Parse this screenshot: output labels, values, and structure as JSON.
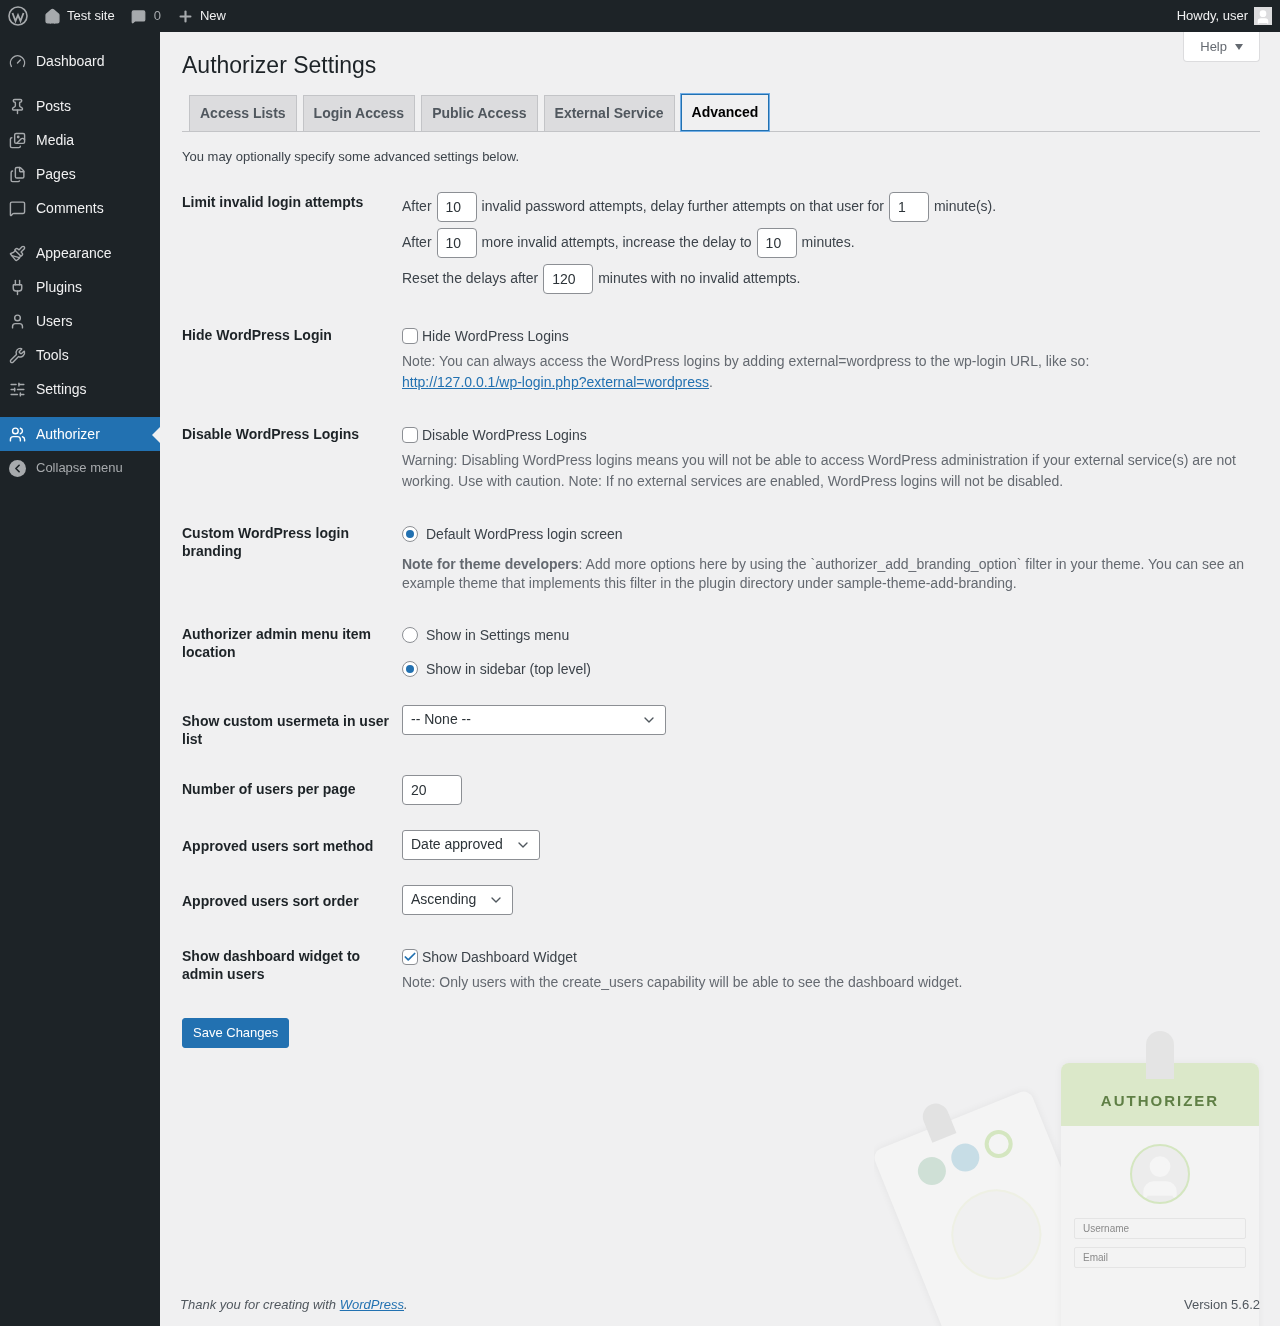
{
  "admin_bar": {
    "site": "Test site",
    "comments": "0",
    "new": "New",
    "greeting": "Howdy, user"
  },
  "sidebar": {
    "groups": [
      [
        {
          "label": "Dashboard",
          "selected": false
        }
      ],
      [
        {
          "label": "Posts",
          "selected": false
        },
        {
          "label": "Media",
          "selected": false
        },
        {
          "label": "Pages",
          "selected": false
        },
        {
          "label": "Comments",
          "selected": false
        }
      ],
      [
        {
          "label": "Appearance",
          "selected": false
        },
        {
          "label": "Plugins",
          "selected": false
        },
        {
          "label": "Users",
          "selected": false
        },
        {
          "label": "Tools",
          "selected": false
        },
        {
          "label": "Settings",
          "selected": false
        }
      ],
      [
        {
          "label": "Authorizer",
          "selected": true
        }
      ]
    ],
    "collapse": "Collapse menu"
  },
  "help": "Help",
  "title": "Authorizer Settings",
  "tabs": [
    {
      "label": "Access Lists",
      "selected": false
    },
    {
      "label": "Login Access",
      "selected": false
    },
    {
      "label": "Public Access",
      "selected": false
    },
    {
      "label": "External Service",
      "selected": false
    },
    {
      "label": "Advanced",
      "selected": true
    }
  ],
  "intro": "You may optionally specify some advanced settings below.",
  "settings": [
    {
      "kind": "attempts",
      "label": "Limit invalid login attempts",
      "lines": [
        [
          {
            "text": "After"
          },
          {
            "value": "10"
          },
          {
            "text": "invalid password attempts, delay further attempts on that user for"
          },
          {
            "value": "1"
          },
          {
            "text": "minute(s)."
          }
        ],
        [
          {
            "text": "After"
          },
          {
            "value": "10"
          },
          {
            "text": "more invalid attempts, increase the delay to"
          },
          {
            "value": "10"
          },
          {
            "text": "minutes."
          }
        ],
        [
          {
            "text": "Reset the delays after"
          },
          {
            "value": "120"
          },
          {
            "text": "minutes with no invalid attempts."
          }
        ]
      ]
    },
    {
      "kind": "checkbox",
      "label": "Hide WordPress Login",
      "option": "Hide WordPress Logins",
      "checked": false,
      "note": "Note: You can always access the WordPress logins by adding external=wordpress to the wp-login URL, like so:",
      "link": "http://127.0.0.1/wp-login.php?external=wordpress",
      "link_suffix": "."
    },
    {
      "kind": "checkbox",
      "label": "Disable WordPress Logins",
      "option": "Disable WordPress Logins",
      "checked": false,
      "note": "Warning: Disabling WordPress logins means you will not be able to access WordPress administration if your external service(s) are not working. Use with caution. Note: If no external services are enabled, WordPress logins will not be disabled."
    },
    {
      "kind": "radio",
      "label": "Custom WordPress login branding",
      "options": [
        {
          "label": "Default WordPress login screen",
          "selected": true
        }
      ],
      "note": "**Note for theme developers**: Add more options here by using the `authorizer_add_branding_option` filter in your theme. You can see an example theme that implements this filter in the plugin directory under sample-theme-add-branding."
    },
    {
      "kind": "radio",
      "label": "Authorizer admin menu item location",
      "options": [
        {
          "label": "Show in Settings menu",
          "selected": false
        },
        {
          "label": "Show in sidebar (top level)",
          "selected": true
        }
      ]
    },
    {
      "kind": "wide_select",
      "label": "Show custom usermeta in user list",
      "value": "-- None --"
    },
    {
      "kind": "number",
      "label": "Number of users per page",
      "value": "20"
    },
    {
      "kind": "select",
      "label": "Approved users sort method",
      "value": "Date approved"
    },
    {
      "kind": "select",
      "label": "Approved users sort order",
      "value": "Ascending"
    },
    {
      "kind": "checkbox",
      "label": "Show dashboard widget to admin users",
      "option": "Show Dashboard Widget",
      "checked": true,
      "note": "Note: Only users with the create_users capability will be able to see the dashboard widget."
    }
  ],
  "save": "Save Changes",
  "illustration": {
    "brand": "AUTHORIZER",
    "username": "Username",
    "email": "Email"
  },
  "footer": {
    "thanks": "Thank you for creating with",
    "link": "WordPress",
    "suffix": ".",
    "version": "Version 5.6.2"
  }
}
